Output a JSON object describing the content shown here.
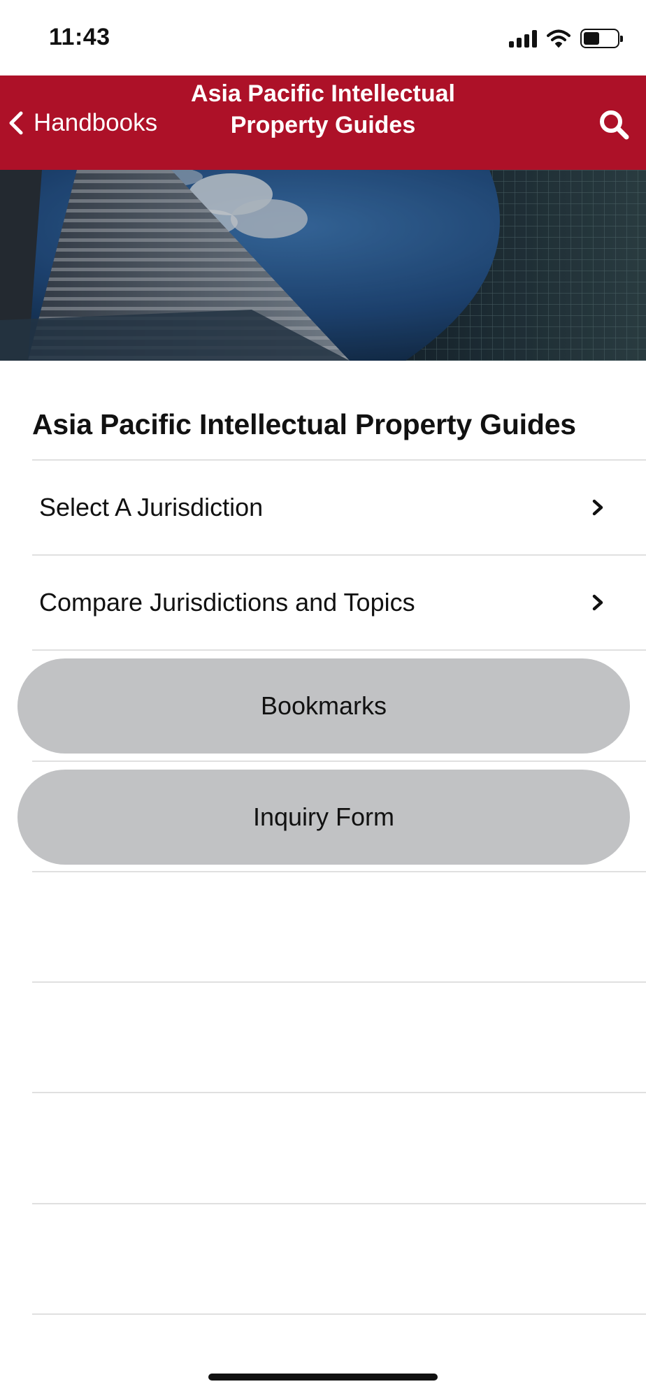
{
  "status_bar": {
    "time": "11:43"
  },
  "nav": {
    "back_label": "Handbooks",
    "title": "Asia Pacific Intellectual Property Guides",
    "bar_color": "#ad1128"
  },
  "icons": {
    "back": "chevron-left-icon",
    "search": "search-icon",
    "row_disclosure": "chevron-right-icon"
  },
  "page": {
    "heading": "Asia Pacific Intellectual Property Guides",
    "rows": [
      {
        "label": "Select A Jurisdiction"
      },
      {
        "label": "Compare Jurisdictions and Topics"
      }
    ],
    "buttons": [
      {
        "label": "Bookmarks"
      },
      {
        "label": "Inquiry Form"
      }
    ],
    "button_color": "#c1c2c4"
  }
}
